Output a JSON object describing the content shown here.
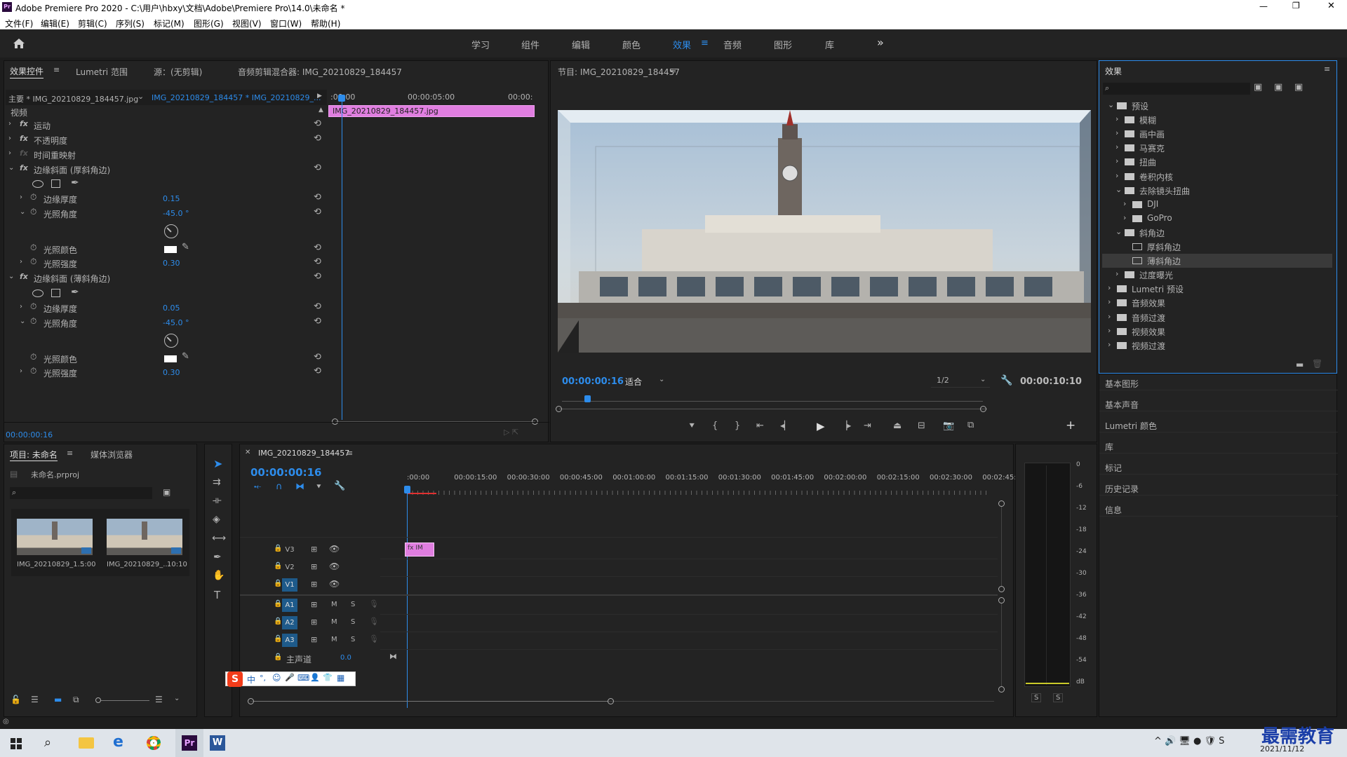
{
  "app": {
    "title": "Adobe Premiere Pro 2020 - C:\\用户\\hbxy\\文档\\Adobe\\Premiere Pro\\14.0\\未命名 *",
    "logo": "Pr"
  },
  "window_controls": {
    "minimize": "—",
    "maximize": "❐",
    "close": "✕"
  },
  "menu": [
    "文件(F)",
    "编辑(E)",
    "剪辑(C)",
    "序列(S)",
    "标记(M)",
    "图形(G)",
    "视图(V)",
    "窗口(W)",
    "帮助(H)"
  ],
  "workspaces": {
    "tabs": [
      "学习",
      "组件",
      "编辑",
      "颜色",
      "效果",
      "音频",
      "图形",
      "库"
    ],
    "active": "效果",
    "more": "»"
  },
  "effect_controls": {
    "tabs": [
      "效果控件",
      "Lumetri 范围",
      "源：(无剪辑)",
      "音频剪辑混合器: IMG_20210829_184457"
    ],
    "master": "主要 * IMG_20210829_184457.jpg",
    "sequence": "IMG_20210829_184457 * IMG_20210829_...",
    "timeline_times": [
      ":00:00",
      "00:00:05:00",
      "00:00:"
    ],
    "clip_name": "IMG_20210829_184457.jpg",
    "section": "视频",
    "props": [
      {
        "label": "运动"
      },
      {
        "label": "不透明度"
      },
      {
        "label": "时间重映射"
      },
      {
        "label": "边缘斜面 (厚斜角边)"
      }
    ],
    "thick": {
      "thickness_label": "边缘厚度",
      "thickness": "0.15",
      "angle_label": "光照角度",
      "angle": "-45.0 °",
      "color_label": "光照颜色",
      "intensity_label": "光照强度",
      "intensity": "0.30"
    },
    "thin_title": "边缘斜面 (薄斜角边)",
    "thin": {
      "thickness_label": "边缘厚度",
      "thickness": "0.05",
      "angle_label": "光照角度",
      "angle": "-45.0 °",
      "color_label": "光照颜色",
      "intensity_label": "光照强度",
      "intensity": "0.30"
    },
    "timecode": "00:00:00:16"
  },
  "program": {
    "title": "节目: IMG_20210829_184457",
    "timecode": "00:00:00:16",
    "fit": "适合",
    "resolution": "1/2",
    "duration": "00:00:10:10"
  },
  "effects_panel": {
    "title": "效果",
    "tree": [
      {
        "label": "预设",
        "level": 0,
        "open": true
      },
      {
        "label": "模糊",
        "level": 1
      },
      {
        "label": "画中画",
        "level": 1
      },
      {
        "label": "马赛克",
        "level": 1
      },
      {
        "label": "扭曲",
        "level": 1
      },
      {
        "label": "卷积内核",
        "level": 1
      },
      {
        "label": "去除镜头扭曲",
        "level": 1,
        "open": true
      },
      {
        "label": "DJI",
        "level": 2
      },
      {
        "label": "GoPro",
        "level": 2
      },
      {
        "label": "斜角边",
        "level": 1,
        "open": true
      },
      {
        "label": "厚斜角边",
        "level": 2,
        "leaf": true
      },
      {
        "label": "薄斜角边",
        "level": 2,
        "leaf": true,
        "selected": true
      },
      {
        "label": "过度曝光",
        "level": 1
      },
      {
        "label": "Lumetri 预设",
        "level": 0
      },
      {
        "label": "音频效果",
        "level": 0
      },
      {
        "label": "音频过渡",
        "level": 0
      },
      {
        "label": "视频效果",
        "level": 0
      },
      {
        "label": "视频过渡",
        "level": 0
      }
    ],
    "side_panels": [
      "基本图形",
      "基本声音",
      "Lumetri 颜色",
      "库",
      "标记",
      "历史记录",
      "信息"
    ]
  },
  "project": {
    "tabs": [
      "项目: 未命名",
      "媒体浏览器"
    ],
    "file": "未命名.prproj",
    "items": [
      {
        "name": "IMG_20210829_1...",
        "duration": "5:00"
      },
      {
        "name": "IMG_20210829_...",
        "duration": "10:10"
      }
    ]
  },
  "timeline": {
    "title": "IMG_20210829_184457",
    "timecode": "00:00:00:16",
    "ruler": [
      ":00:00",
      "00:00:15:00",
      "00:00:30:00",
      "00:00:45:00",
      "00:01:00:00",
      "00:01:15:00",
      "00:01:30:00",
      "00:01:45:00",
      "00:02:00:00",
      "00:02:15:00",
      "00:02:30:00",
      "00:02:45:"
    ],
    "video_tracks": [
      "V3",
      "V2",
      "V1"
    ],
    "audio_tracks": [
      "A1",
      "A2",
      "A3"
    ],
    "master_label": "主声道",
    "master_value": "0.0",
    "clip_label": "fx IM"
  },
  "meter": {
    "scale": [
      "0",
      "-6",
      "-12",
      "-18",
      "-24",
      "-30",
      "-36",
      "-42",
      "-48",
      "-54",
      "dB"
    ],
    "solo": [
      "S",
      "S"
    ]
  },
  "ime": {
    "logo": "S",
    "items": [
      "中",
      "°,",
      "☺",
      "🎤",
      "⌨",
      "👤",
      "👕",
      "▦"
    ]
  },
  "taskbar": {
    "date": "2021/11/12",
    "watermark": "最需教育"
  },
  "colors": {
    "accent": "#2d8ceb",
    "clip_pink": "#e07ee0",
    "panel": "#232323"
  }
}
